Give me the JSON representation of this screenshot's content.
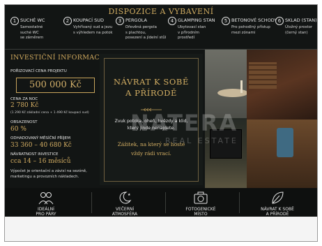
{
  "header": {
    "title": "DISPOZICE A VYBAVENÍ",
    "steps": [
      {
        "num": "1",
        "title": "SUCHÉ WC",
        "desc": [
          "Samostatné",
          "suché WC",
          "se záměrem"
        ]
      },
      {
        "num": "2",
        "title": "KOUPACÍ SUD",
        "desc": [
          "Vyhřívaný sud a jezu",
          "s výhledem na potok"
        ]
      },
      {
        "num": "3",
        "title": "PERGOLA",
        "desc": [
          "Dřevěná pergola",
          "s plachtou,",
          "posezení a jídelní stůl"
        ]
      },
      {
        "num": "4",
        "title": "GLAMPING STAN",
        "desc": [
          "Ubytovací stan",
          "v přírodním",
          "prostředí"
        ]
      },
      {
        "num": "5",
        "title": "BETONOVÉ SCHODY",
        "desc": [
          "Pro pohodlný přístup",
          "mezi zónami"
        ]
      },
      {
        "num": "6",
        "title": "SKLAD (STAN)",
        "desc": [
          "Úložný prostor",
          "(černý stan)"
        ]
      }
    ]
  },
  "investment": {
    "title": "INVESTIČNÍ INFORMACE",
    "price_label": "POŘIZOVACÍ CENA PROJEKTU",
    "price": "500 000 Kč",
    "night_label": "CENA ZA NOC",
    "night_value": "2 780 Kč",
    "night_note": "(1 290 Kč základní cena + 1 490 Kč koupací sud)",
    "occupancy_label": "OBSAZENOST",
    "occupancy_value": "60 %",
    "income_label": "ODHADOVANÝ MĚSÍČNÍ PŘÍJEM",
    "income_value": "33 360 – 40 680 Kč",
    "return_label": "NÁVRATNOST INVESTICE",
    "return_value": "cca 14 – 16 měsíců",
    "note": [
      "Výpočet je orientační a závisí na sezóně,",
      "marketingu a provozních nákladech."
    ]
  },
  "center": {
    "heading": [
      "NÁVRAT K SOBĚ",
      "A PŘÍRODĚ"
    ],
    "text": [
      "Zvuk potoka, oheň, hvězdy a klid,",
      "který jinde nenajdete."
    ],
    "gold_text": [
      "Zážitek, na který se hosté",
      "vždy rádi vrací."
    ]
  },
  "watermark": {
    "big": "NATERA",
    "small": "REAL ESTATE"
  },
  "bottom": [
    {
      "icon": "people-icon",
      "label": [
        "IDEÁLNÍ",
        "PRO PÁRY"
      ]
    },
    {
      "icon": "moon-stars-icon",
      "label": [
        "VEČERNÍ",
        "ATMOSFÉRA"
      ]
    },
    {
      "icon": "camera-icon",
      "label": [
        "FOTOGENICKÉ",
        "MÍSTO"
      ]
    },
    {
      "icon": "leaf-icon",
      "label": [
        "NÁVRAT K SOBĚ",
        "A PŘÍRODĚ"
      ]
    }
  ],
  "colors": {
    "accent": "#c9a55c",
    "background": "#121514"
  }
}
